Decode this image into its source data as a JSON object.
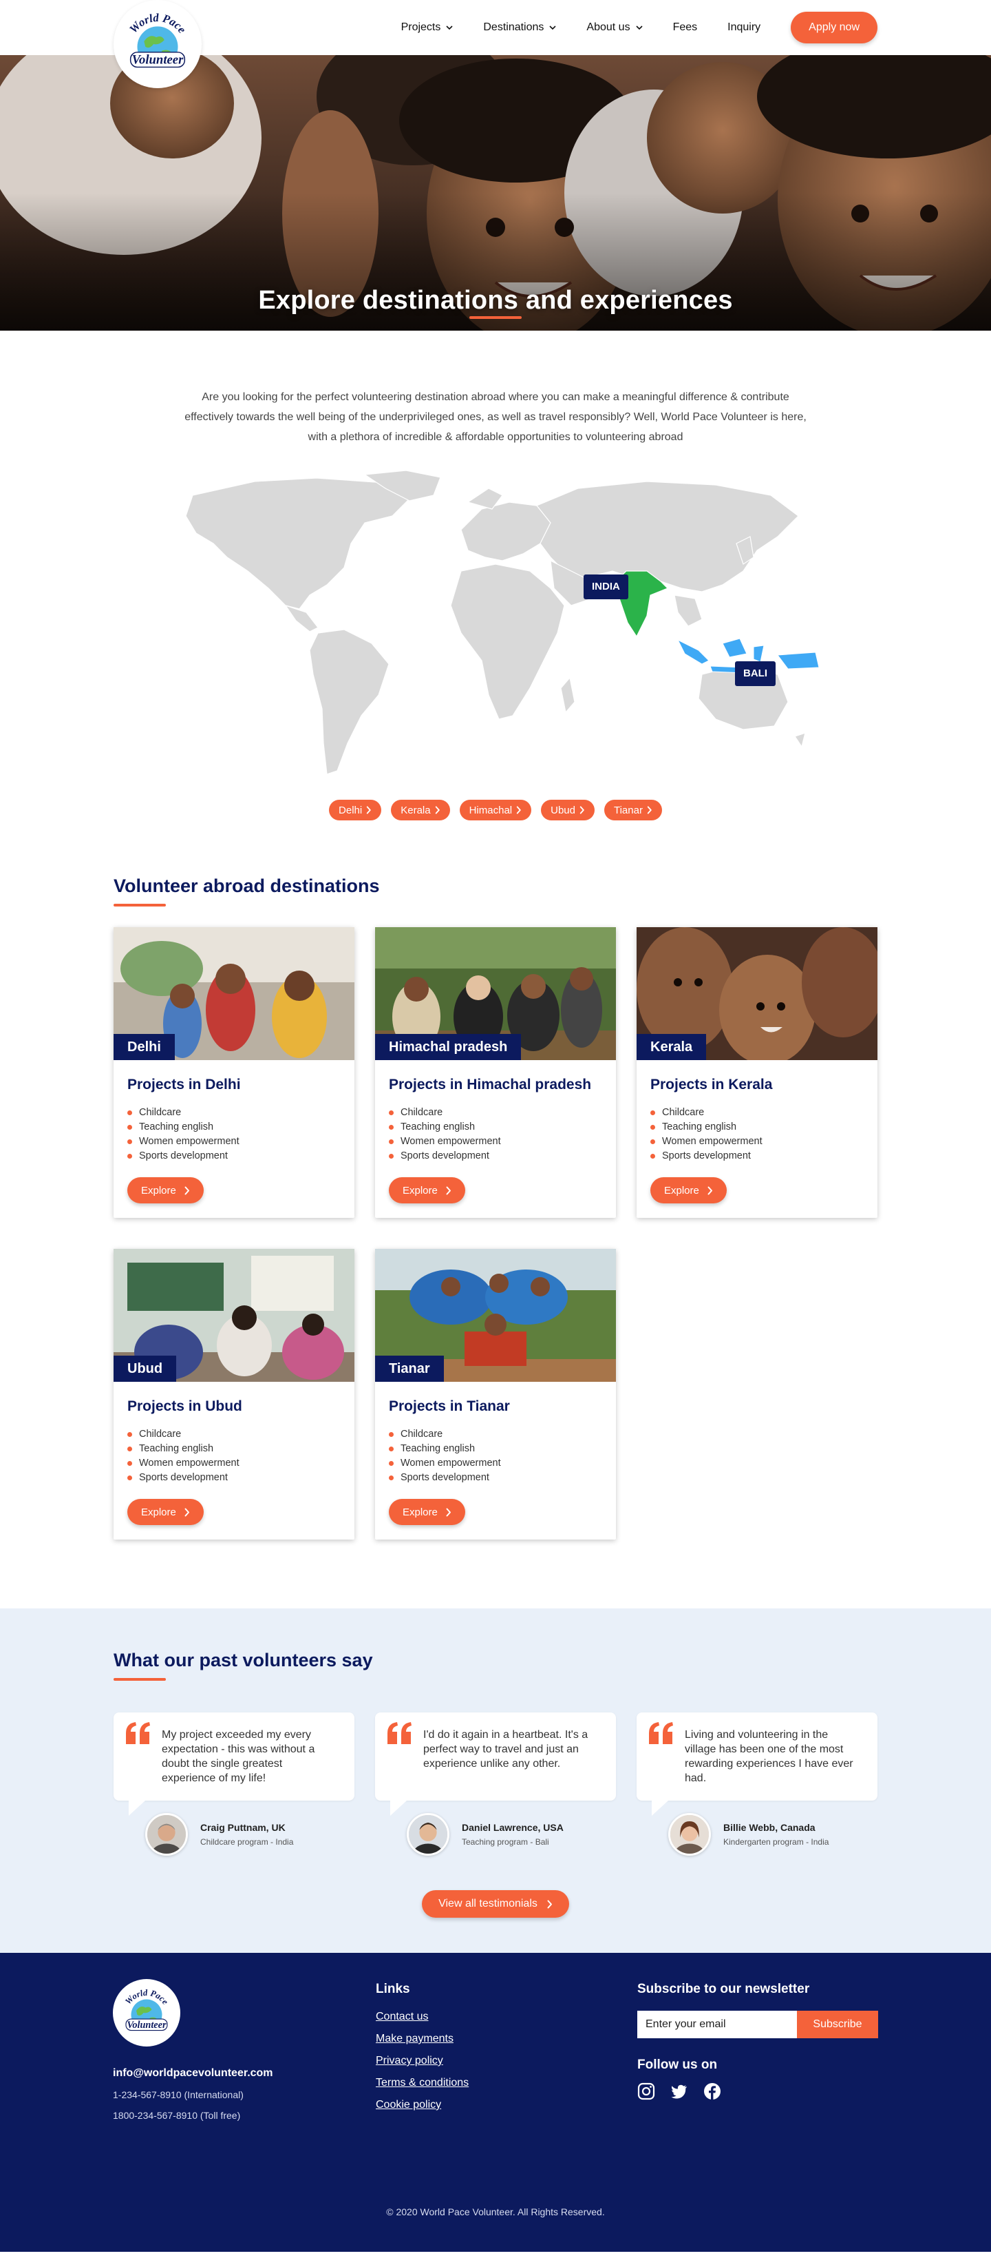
{
  "brand": {
    "logo_line1": "World Pace",
    "logo_line2": "Volunteer",
    "accent": "#f4623a",
    "navy": "#0c1a5e"
  },
  "nav": {
    "items": [
      {
        "label": "Projects",
        "dropdown": true
      },
      {
        "label": "Destinations",
        "dropdown": true
      },
      {
        "label": "About us",
        "dropdown": true
      },
      {
        "label": "Fees",
        "dropdown": false
      },
      {
        "label": "Inquiry",
        "dropdown": false
      }
    ],
    "apply_label": "Apply now"
  },
  "hero": {
    "title": "Explore destinations and experiences"
  },
  "intro": {
    "text": "Are you looking for the perfect volunteering destination abroad where you can make a meaningful difference & contribute effectively towards the well being of the underprivileged ones, as well as travel responsibly? Well, World Pace Volunteer is here, with a plethora of incredible & affordable opportunities to volunteering abroad"
  },
  "map": {
    "tag_india": "INDIA",
    "tag_bali": "BALI",
    "india_color": "#2bb34a",
    "indonesia_color": "#3fa9f5",
    "pills": [
      "Delhi",
      "Kerala",
      "Himachal",
      "Ubud",
      "Tianar"
    ]
  },
  "destinations": {
    "title": "Volunteer abroad destinations",
    "explore_label": "Explore",
    "cards": [
      {
        "tag": "Delhi",
        "title": "Projects in Delhi",
        "items": [
          "Childcare",
          "Teaching english",
          "Women empowerment",
          "Sports development"
        ]
      },
      {
        "tag": "Himachal pradesh",
        "title": "Projects in Himachal pradesh",
        "items": [
          "Childcare",
          "Teaching english",
          "Women empowerment",
          "Sports development"
        ]
      },
      {
        "tag": "Kerala",
        "title": "Projects in Kerala",
        "items": [
          "Childcare",
          "Teaching english",
          "Women empowerment",
          "Sports development"
        ]
      },
      {
        "tag": "Ubud",
        "title": "Projects in Ubud",
        "items": [
          "Childcare",
          "Teaching english",
          "Women empowerment",
          "Sports development"
        ]
      },
      {
        "tag": "Tianar",
        "title": "Projects in Tianar",
        "items": [
          "Childcare",
          "Teaching english",
          "Women empowerment",
          "Sports development"
        ]
      }
    ]
  },
  "testimonials": {
    "title": "What our past volunteers say",
    "items": [
      {
        "quote": "My project exceeded my every expectation - this was without a doubt the single greatest experience of my life!",
        "name": "Craig Puttnam, UK",
        "program": "Childcare program - India"
      },
      {
        "quote": "I'd do it again in a heartbeat. It's a perfect way to travel and just an experience unlike any other.",
        "name": "Daniel Lawrence, USA",
        "program": "Teaching program - Bali"
      },
      {
        "quote": "Living and volunteering in the village has been one of the most rewarding experiences I have ever had.",
        "name": "Billie Webb, Canada",
        "program": "Kindergarten program - India"
      }
    ],
    "view_all_label": "View all testimonials"
  },
  "footer": {
    "email": "info@worldpacevolunteer.com",
    "phone_intl": "1-234-567-8910 (International)",
    "phone_free": "1800-234-567-8910 (Toll free)",
    "links_title": "Links",
    "links": [
      "Contact us",
      "Make payments",
      "Privacy policy",
      "Terms & conditions",
      "Cookie policy"
    ],
    "newsletter_title": "Subscribe to our newsletter",
    "newsletter_placeholder": "Enter your email",
    "subscribe_label": "Subscribe",
    "follow_title": "Follow us on",
    "socials": [
      "instagram-icon",
      "twitter-icon",
      "facebook-icon"
    ],
    "copyright": "© 2020 World Pace Volunteer. All Rights Reserved."
  }
}
